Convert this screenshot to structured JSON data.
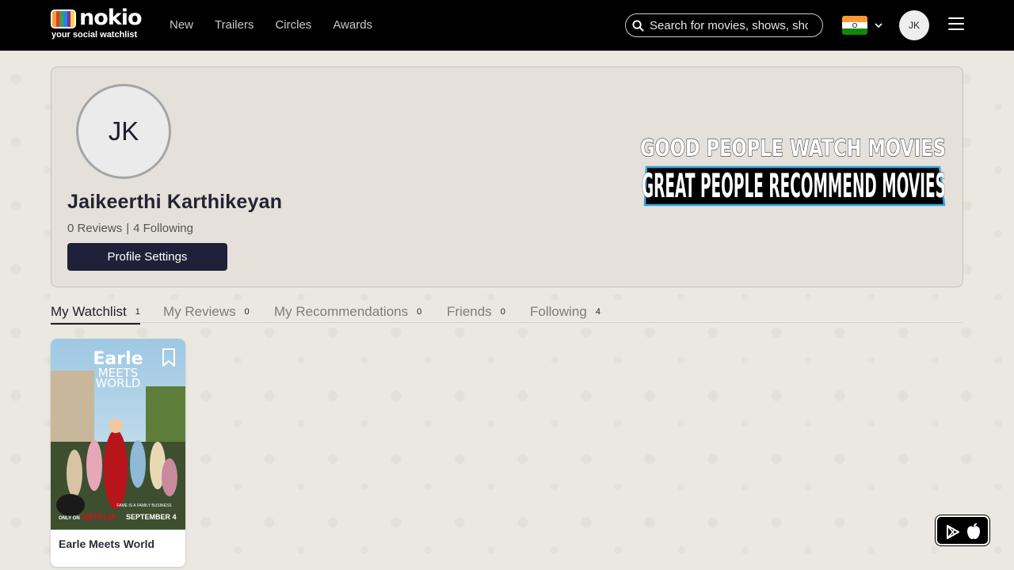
{
  "brand": {
    "name": "nokio",
    "tagline": "your social watchlist",
    "logo_colors": [
      "#f7a02c",
      "#e53935",
      "#43a047",
      "#1e88e5",
      "#8e24aa",
      "#fdd835"
    ]
  },
  "nav": {
    "links": [
      "New",
      "Trailers",
      "Circles",
      "Awards"
    ],
    "search_placeholder": "Search for movies, shows, shorts...",
    "country_flag": "india-flag-icon",
    "user_initials": "JK"
  },
  "profile": {
    "initials": "JK",
    "name": "Jaikeerthi Karthikeyan",
    "reviews_text": "0 Reviews",
    "separator": "|",
    "following_text": "4 Following",
    "settings_label": "Profile Settings",
    "banner_line1": "GOOD PEOPLE WATCH MOVIES",
    "banner_line2": "GREAT PEOPLE RECOMMEND MOVIES"
  },
  "tabs": [
    {
      "label": "My Watchlist",
      "count": "1",
      "active": true
    },
    {
      "label": "My Reviews",
      "count": "0",
      "active": false
    },
    {
      "label": "My Recommendations",
      "count": "0",
      "active": false
    },
    {
      "label": "Friends",
      "count": "0",
      "active": false
    },
    {
      "label": "Following",
      "count": "4",
      "active": false
    }
  ],
  "watchlist": [
    {
      "title": "Earle Meets World",
      "poster_title_1": "Earle",
      "poster_title_2": "MEETS",
      "poster_title_3": "WORLD",
      "poster_tagline": "FAME IS A FAMILY BUSINESS",
      "poster_only_on": "ONLY ON",
      "poster_network": "NETFLIX",
      "poster_date": "SEPTEMBER 4"
    }
  ],
  "colors": {
    "topbar": "#000000",
    "button": "#20203a",
    "page_bg": "#ebe8e1"
  }
}
